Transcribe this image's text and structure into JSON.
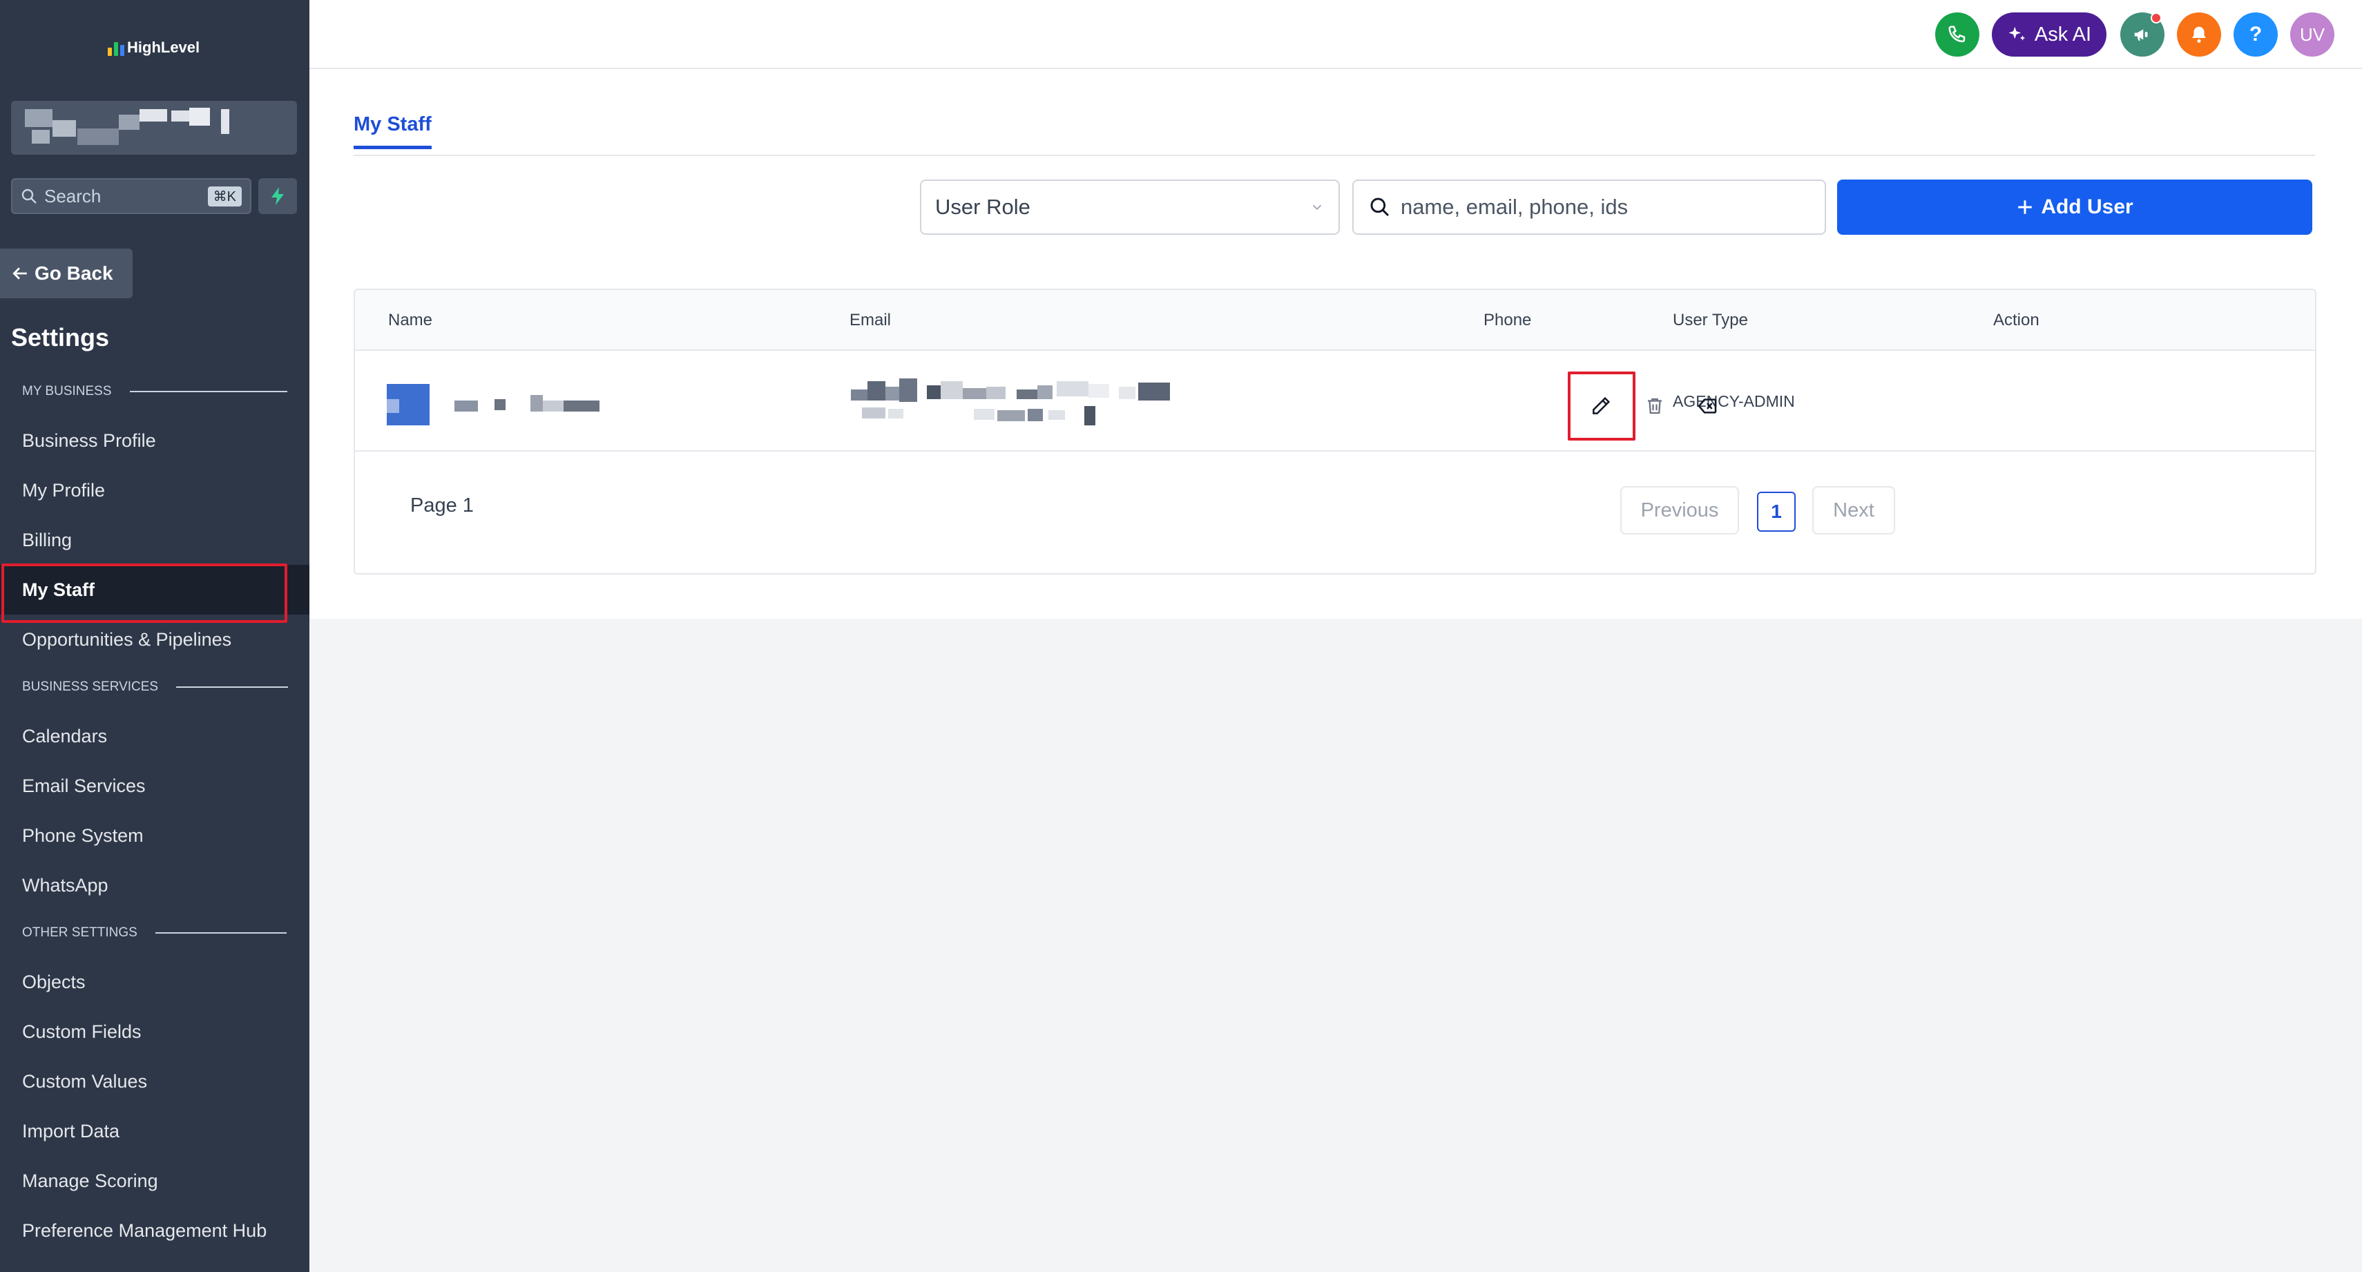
{
  "app": {
    "logo_text": "HighLevel"
  },
  "sidebar": {
    "search_placeholder": "Search",
    "search_shortcut": "⌘K",
    "go_back": "Go Back",
    "settings_title": "Settings",
    "sections": {
      "my_business": "MY BUSINESS",
      "business_services": "BUSINESS SERVICES",
      "other_settings": "OTHER SETTINGS"
    },
    "items": [
      "Business Profile",
      "My Profile",
      "Billing",
      "My Staff",
      "Opportunities & Pipelines",
      "Calendars",
      "Email Services",
      "Phone System",
      "WhatsApp",
      "Objects",
      "Custom Fields",
      "Custom Values",
      "Import Data",
      "Manage Scoring",
      "Preference Management Hub"
    ],
    "active_item": "My Staff"
  },
  "topbar": {
    "ask_ai": "Ask AI",
    "avatar_initials": "UV",
    "help_glyph": "?",
    "icons": [
      "phone-icon",
      "sparkle-icon",
      "megaphone-icon",
      "bell-icon",
      "help-icon"
    ],
    "colors": {
      "phone": "#16a34a",
      "ask_ai": "#4c1d95",
      "megaphone": "#3f8f7a",
      "bell": "#f97316",
      "help": "#1e90ff",
      "avatar": "#c084d0"
    }
  },
  "main": {
    "tabs": [
      {
        "label": "My Staff",
        "active": true
      }
    ],
    "filters": {
      "role_select_value": "User Role",
      "search_placeholder": "name, email, phone, ids"
    },
    "add_user_label": "Add User",
    "table": {
      "columns": [
        "Name",
        "Email",
        "Phone",
        "User Type",
        "Action"
      ],
      "rows": [
        {
          "name": "",
          "email": "",
          "phone": "",
          "user_type": "AGENCY-ADMIN"
        }
      ]
    },
    "pagination": {
      "page_label": "Page 1",
      "previous": "Previous",
      "next": "Next",
      "current_page": "1"
    }
  },
  "colors": {
    "sidebar_bg": "#2d3748",
    "accent": "#155eef",
    "highlight_box": "#e11d2e"
  }
}
